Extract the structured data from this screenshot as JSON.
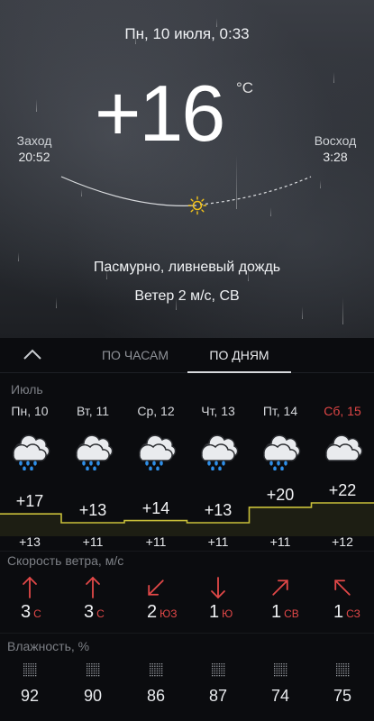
{
  "header": {
    "date": "Пн, 10 июля, 0:33",
    "temperature": "+16",
    "unit": "°C",
    "sunset_label": "Заход",
    "sunset_time": "20:52",
    "sunrise_label": "Восход",
    "sunrise_time": "3:28",
    "condition": "Пасмурно, ливневый дождь",
    "wind": "Ветер 2 м/с, СВ"
  },
  "tabs": {
    "hourly": "ПО ЧАСАМ",
    "daily": "ПО ДНЯМ",
    "active": "daily"
  },
  "month": "Июль",
  "days": [
    {
      "name": "Пн, 10",
      "weekend": false,
      "icon": "cloud-rain-icon",
      "hi": "+17",
      "lo": "+13",
      "wind": "3",
      "wind_dir": "С",
      "humidity": "92"
    },
    {
      "name": "Вт, 11",
      "weekend": false,
      "icon": "cloud-rain-icon",
      "hi": "+13",
      "lo": "+11",
      "wind": "3",
      "wind_dir": "С",
      "humidity": "90"
    },
    {
      "name": "Ср, 12",
      "weekend": false,
      "icon": "cloud-rain-icon",
      "hi": "+14",
      "lo": "+11",
      "wind": "2",
      "wind_dir": "ЮЗ",
      "humidity": "86"
    },
    {
      "name": "Чт, 13",
      "weekend": false,
      "icon": "cloud-rain-icon",
      "hi": "+13",
      "lo": "+11",
      "wind": "1",
      "wind_dir": "Ю",
      "humidity": "87"
    },
    {
      "name": "Пт, 14",
      "weekend": false,
      "icon": "cloud-rain-icon",
      "hi": "+20",
      "lo": "+11",
      "wind": "1",
      "wind_dir": "СВ",
      "humidity": "74"
    },
    {
      "name": "Сб, 15",
      "weekend": true,
      "icon": "cloud-icon",
      "hi": "+22",
      "lo": "+12",
      "wind": "1",
      "wind_dir": "СЗ",
      "humidity": "75"
    }
  ],
  "sections": {
    "wind_title": "Скорость ветра, м/с",
    "humidity_title": "Влажность, %"
  },
  "colors": {
    "accent_red": "#e24848",
    "chart_line": "#c9c03a",
    "weekend": "#e04646",
    "rain": "#2f8fe8",
    "sun": "#f2c21a"
  }
}
